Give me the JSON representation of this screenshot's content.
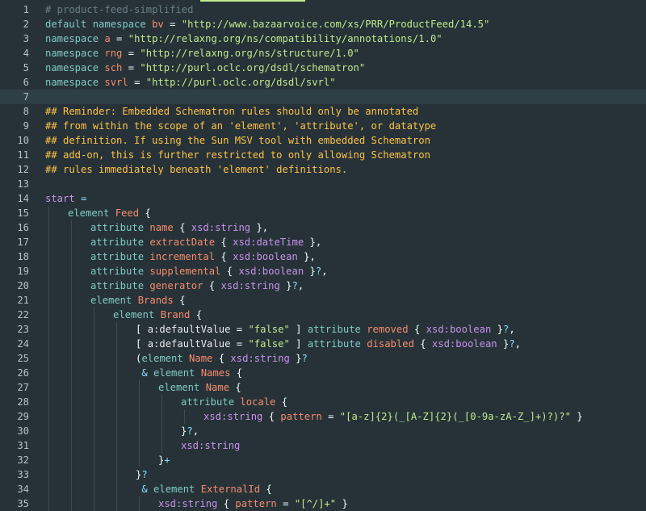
{
  "editor": {
    "active_line": 7,
    "tab_indicator_color": "#c3e88d",
    "lines": [
      {
        "n": "1",
        "indent": 0,
        "tokens": [
          {
            "t": "# product-feed-simplified",
            "c": "comment"
          }
        ]
      },
      {
        "n": "2",
        "indent": 0,
        "tokens": [
          {
            "t": "default namespace ",
            "c": "keyword"
          },
          {
            "t": "bv",
            "c": "name"
          },
          {
            "t": " = ",
            "c": "punct"
          },
          {
            "t": "\"http://www.bazaarvoice.com/xs/PRR/ProductFeed/14.5\"",
            "c": "string"
          }
        ]
      },
      {
        "n": "3",
        "indent": 0,
        "tokens": [
          {
            "t": "namespace ",
            "c": "keyword"
          },
          {
            "t": "a",
            "c": "name"
          },
          {
            "t": " = ",
            "c": "punct"
          },
          {
            "t": "\"http://relaxng.org/ns/compatibility/annotations/1.0\"",
            "c": "string"
          }
        ]
      },
      {
        "n": "4",
        "indent": 0,
        "tokens": [
          {
            "t": "namespace ",
            "c": "keyword"
          },
          {
            "t": "rng",
            "c": "name"
          },
          {
            "t": " = ",
            "c": "punct"
          },
          {
            "t": "\"http://relaxng.org/ns/structure/1.0\"",
            "c": "string"
          }
        ]
      },
      {
        "n": "5",
        "indent": 0,
        "tokens": [
          {
            "t": "namespace ",
            "c": "keyword"
          },
          {
            "t": "sch",
            "c": "name"
          },
          {
            "t": " = ",
            "c": "punct"
          },
          {
            "t": "\"http://purl.oclc.org/dsdl/schematron\"",
            "c": "string"
          }
        ]
      },
      {
        "n": "6",
        "indent": 0,
        "tokens": [
          {
            "t": "namespace ",
            "c": "keyword"
          },
          {
            "t": "svrl",
            "c": "name"
          },
          {
            "t": " = ",
            "c": "punct"
          },
          {
            "t": "\"http://purl.oclc.org/dsdl/svrl\"",
            "c": "string"
          }
        ]
      },
      {
        "n": "7",
        "indent": 0,
        "tokens": []
      },
      {
        "n": "8",
        "indent": 0,
        "tokens": [
          {
            "t": "## Reminder: Embedded Schematron rules should only be annotated",
            "c": "doc"
          }
        ]
      },
      {
        "n": "9",
        "indent": 0,
        "tokens": [
          {
            "t": "## from within the scope of an 'element', 'attribute', or datatype",
            "c": "doc"
          }
        ]
      },
      {
        "n": "10",
        "indent": 0,
        "tokens": [
          {
            "t": "## definition. If using the Sun MSV tool with embedded Schematron",
            "c": "doc"
          }
        ]
      },
      {
        "n": "11",
        "indent": 0,
        "tokens": [
          {
            "t": "## add-on, this is further restricted to only allowing Schematron",
            "c": "doc"
          }
        ]
      },
      {
        "n": "12",
        "indent": 0,
        "tokens": [
          {
            "t": "## rules immediately beneath 'element' definitions.",
            "c": "doc"
          }
        ]
      },
      {
        "n": "13",
        "indent": 0,
        "tokens": []
      },
      {
        "n": "14",
        "indent": 0,
        "tokens": [
          {
            "t": "start",
            "c": "type"
          },
          {
            "t": " =",
            "c": "op"
          }
        ]
      },
      {
        "n": "15",
        "indent": 1,
        "tokens": [
          {
            "t": "element ",
            "c": "keyword"
          },
          {
            "t": "Feed",
            "c": "name"
          },
          {
            "t": " {",
            "c": "punct"
          }
        ]
      },
      {
        "n": "16",
        "indent": 2,
        "tokens": [
          {
            "t": "attribute ",
            "c": "keyword"
          },
          {
            "t": "name",
            "c": "name"
          },
          {
            "t": " { ",
            "c": "punct"
          },
          {
            "t": "xsd:string",
            "c": "type"
          },
          {
            "t": " },",
            "c": "punct"
          }
        ]
      },
      {
        "n": "17",
        "indent": 2,
        "tokens": [
          {
            "t": "attribute ",
            "c": "keyword"
          },
          {
            "t": "extractDate",
            "c": "name"
          },
          {
            "t": " { ",
            "c": "punct"
          },
          {
            "t": "xsd:dateTime",
            "c": "type"
          },
          {
            "t": " },",
            "c": "punct"
          }
        ]
      },
      {
        "n": "18",
        "indent": 2,
        "tokens": [
          {
            "t": "attribute ",
            "c": "keyword"
          },
          {
            "t": "incremental",
            "c": "name"
          },
          {
            "t": " { ",
            "c": "punct"
          },
          {
            "t": "xsd:boolean",
            "c": "type"
          },
          {
            "t": " },",
            "c": "punct"
          }
        ]
      },
      {
        "n": "19",
        "indent": 2,
        "tokens": [
          {
            "t": "attribute ",
            "c": "keyword"
          },
          {
            "t": "supplemental",
            "c": "name"
          },
          {
            "t": " { ",
            "c": "punct"
          },
          {
            "t": "xsd:boolean",
            "c": "type"
          },
          {
            "t": " }",
            "c": "punct"
          },
          {
            "t": "?",
            "c": "op"
          },
          {
            "t": ",",
            "c": "punct"
          }
        ]
      },
      {
        "n": "20",
        "indent": 2,
        "tokens": [
          {
            "t": "attribute ",
            "c": "keyword"
          },
          {
            "t": "generator",
            "c": "name"
          },
          {
            "t": " { ",
            "c": "punct"
          },
          {
            "t": "xsd:string",
            "c": "type"
          },
          {
            "t": " }",
            "c": "punct"
          },
          {
            "t": "?",
            "c": "op"
          },
          {
            "t": ",",
            "c": "punct"
          }
        ]
      },
      {
        "n": "21",
        "indent": 2,
        "tokens": [
          {
            "t": "element ",
            "c": "keyword"
          },
          {
            "t": "Brands",
            "c": "name"
          },
          {
            "t": " {",
            "c": "punct"
          }
        ]
      },
      {
        "n": "22",
        "indent": 3,
        "tokens": [
          {
            "t": "element ",
            "c": "keyword"
          },
          {
            "t": "Brand",
            "c": "name"
          },
          {
            "t": " {",
            "c": "punct"
          }
        ]
      },
      {
        "n": "23",
        "indent": 4,
        "tokens": [
          {
            "t": "[ ",
            "c": "punct"
          },
          {
            "t": "a:defaultValue",
            "c": "text"
          },
          {
            "t": " = ",
            "c": "punct"
          },
          {
            "t": "\"false\"",
            "c": "string"
          },
          {
            "t": " ] ",
            "c": "punct"
          },
          {
            "t": "attribute ",
            "c": "keyword"
          },
          {
            "t": "removed",
            "c": "name"
          },
          {
            "t": " { ",
            "c": "punct"
          },
          {
            "t": "xsd:boolean",
            "c": "type"
          },
          {
            "t": " }",
            "c": "punct"
          },
          {
            "t": "?",
            "c": "op"
          },
          {
            "t": ",",
            "c": "punct"
          }
        ]
      },
      {
        "n": "24",
        "indent": 4,
        "tokens": [
          {
            "t": "[ ",
            "c": "punct"
          },
          {
            "t": "a:defaultValue",
            "c": "text"
          },
          {
            "t": " = ",
            "c": "punct"
          },
          {
            "t": "\"false\"",
            "c": "string"
          },
          {
            "t": " ] ",
            "c": "punct"
          },
          {
            "t": "attribute ",
            "c": "keyword"
          },
          {
            "t": "disabled",
            "c": "name"
          },
          {
            "t": " { ",
            "c": "punct"
          },
          {
            "t": "xsd:boolean",
            "c": "type"
          },
          {
            "t": " }",
            "c": "punct"
          },
          {
            "t": "?",
            "c": "op"
          },
          {
            "t": ",",
            "c": "punct"
          }
        ]
      },
      {
        "n": "25",
        "indent": 4,
        "tokens": [
          {
            "t": "(",
            "c": "punct"
          },
          {
            "t": "element ",
            "c": "keyword"
          },
          {
            "t": "Name",
            "c": "name"
          },
          {
            "t": " { ",
            "c": "punct"
          },
          {
            "t": "xsd:string",
            "c": "type"
          },
          {
            "t": " }",
            "c": "punct"
          },
          {
            "t": "?",
            "c": "op"
          }
        ]
      },
      {
        "n": "26",
        "indent": 4,
        "tokens": [
          {
            "t": " & ",
            "c": "op"
          },
          {
            "t": "element ",
            "c": "keyword"
          },
          {
            "t": "Names",
            "c": "name"
          },
          {
            "t": " {",
            "c": "punct"
          }
        ]
      },
      {
        "n": "27",
        "indent": 5,
        "tokens": [
          {
            "t": "element ",
            "c": "keyword"
          },
          {
            "t": "Name",
            "c": "name"
          },
          {
            "t": " {",
            "c": "punct"
          }
        ]
      },
      {
        "n": "28",
        "indent": 6,
        "tokens": [
          {
            "t": "attribute ",
            "c": "keyword"
          },
          {
            "t": "locale",
            "c": "name"
          },
          {
            "t": " {",
            "c": "punct"
          }
        ]
      },
      {
        "n": "29",
        "indent": 7,
        "tokens": [
          {
            "t": "xsd:string",
            "c": "type"
          },
          {
            "t": " { ",
            "c": "punct"
          },
          {
            "t": "pattern",
            "c": "name"
          },
          {
            "t": " = ",
            "c": "punct"
          },
          {
            "t": "\"[a-z]{2}(_[A-Z]{2}(_[0-9a-zA-Z_]+)?)?\"",
            "c": "string"
          },
          {
            "t": " }",
            "c": "punct"
          }
        ]
      },
      {
        "n": "30",
        "indent": 6,
        "tokens": [
          {
            "t": "}",
            "c": "punct"
          },
          {
            "t": "?",
            "c": "op"
          },
          {
            "t": ",",
            "c": "punct"
          }
        ]
      },
      {
        "n": "31",
        "indent": 6,
        "tokens": [
          {
            "t": "xsd:string",
            "c": "type"
          }
        ]
      },
      {
        "n": "32",
        "indent": 5,
        "tokens": [
          {
            "t": "}",
            "c": "punct"
          },
          {
            "t": "+",
            "c": "op"
          }
        ]
      },
      {
        "n": "33",
        "indent": 4,
        "tokens": [
          {
            "t": "}",
            "c": "punct"
          },
          {
            "t": "?",
            "c": "op"
          }
        ]
      },
      {
        "n": "34",
        "indent": 4,
        "tokens": [
          {
            "t": " & ",
            "c": "op"
          },
          {
            "t": "element ",
            "c": "keyword"
          },
          {
            "t": "ExternalId",
            "c": "name"
          },
          {
            "t": " {",
            "c": "punct"
          }
        ]
      },
      {
        "n": "35",
        "indent": 5,
        "tokens": [
          {
            "t": "xsd:string",
            "c": "type"
          },
          {
            "t": " { ",
            "c": "punct"
          },
          {
            "t": "pattern",
            "c": "name"
          },
          {
            "t": " = ",
            "c": "punct"
          },
          {
            "t": "\"[^/]+\"",
            "c": "string"
          },
          {
            "t": " }",
            "c": "punct"
          }
        ]
      }
    ]
  }
}
